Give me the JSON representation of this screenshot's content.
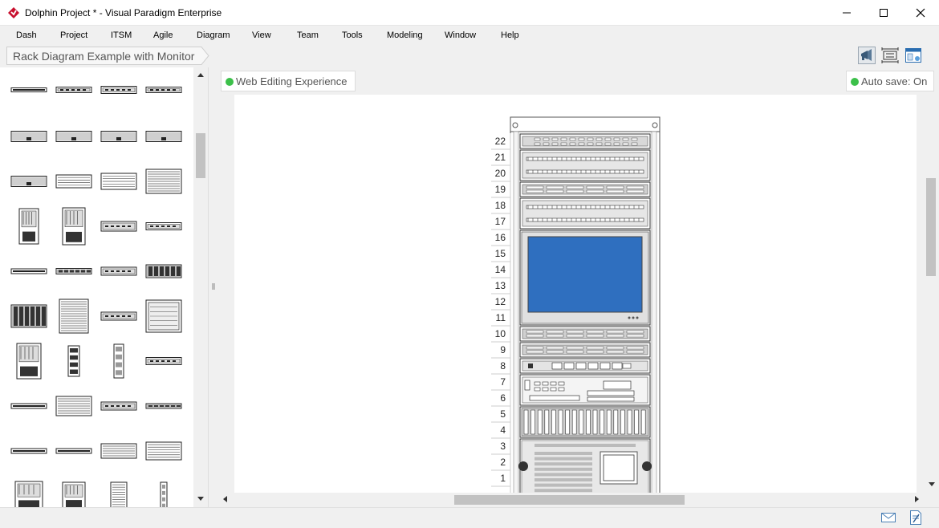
{
  "window": {
    "title": "Dolphin Project * - Visual Paradigm Enterprise",
    "controls": [
      "minimize",
      "maximize",
      "close"
    ]
  },
  "menu": [
    "Dash",
    "Project",
    "ITSM",
    "Agile",
    "Diagram",
    "View",
    "Team",
    "Tools",
    "Modeling",
    "Window",
    "Help"
  ],
  "breadcrumb": {
    "label": "Rack Diagram Example with Monitor"
  },
  "toolbar_icons": [
    "announcement-icon",
    "fit-diagram-icon",
    "panel-layout-icon"
  ],
  "badges": {
    "web_editing": "Web Editing Experience",
    "auto_save": "Auto save: On"
  },
  "rack": {
    "units": [
      "22",
      "21",
      "20",
      "19",
      "18",
      "17",
      "16",
      "15",
      "14",
      "13",
      "12",
      "11",
      "10",
      "9",
      "8",
      "7",
      "6",
      "5",
      "4",
      "3",
      "2",
      "1"
    ],
    "monitor_color": "#2f6fbf"
  },
  "palette": {
    "item_count_visible": 40
  },
  "status_icons": [
    "mail-icon",
    "notes-icon"
  ],
  "colors": {
    "status_green": "#3cc04a",
    "app_icon_red": "#c8102e",
    "monitor_blue": "#2f6fbf"
  }
}
